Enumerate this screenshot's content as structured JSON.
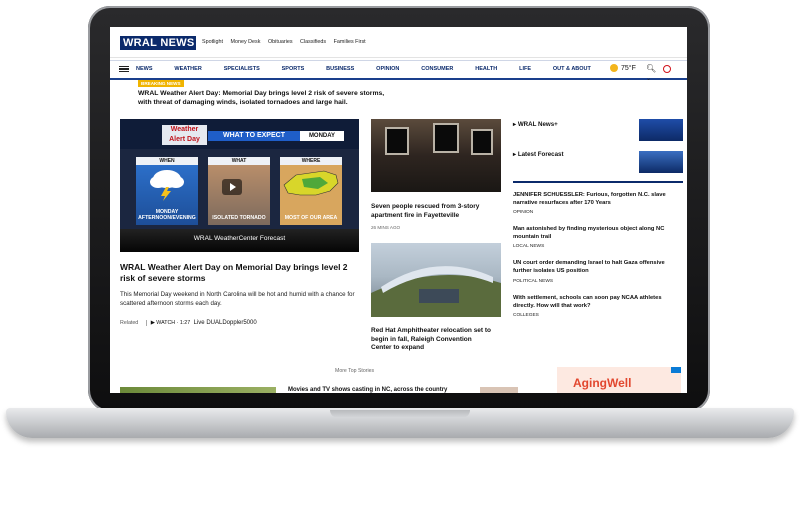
{
  "header": {
    "logo_text": "WRAL NEWS",
    "top_links": [
      "Spotlight",
      "Money Desk",
      "Obituaries",
      "Classifieds",
      "Families First"
    ]
  },
  "nav": {
    "items": [
      "NEWS",
      "WEATHER",
      "SPECIALISTS",
      "SPORTS",
      "BUSINESS",
      "OPINION",
      "CONSUMER",
      "HEALTH",
      "LIFE",
      "OUT & ABOUT"
    ],
    "temperature": "75°F"
  },
  "breaking": {
    "label": "BREAKING NEWS",
    "text": "WRAL Weather Alert Day: Memorial Day brings level 2 risk of severe storms, with threat of damaging winds, isolated tornadoes and large hail."
  },
  "hero": {
    "logo_text": "Weather Alert Day",
    "banner": "WHAT TO EXPECT",
    "day": "MONDAY",
    "panels": [
      {
        "head": "WHEN",
        "text": "MONDAY AFTERNOON/EVENING"
      },
      {
        "head": "WHAT",
        "text": "ISOLATED TORNADO"
      },
      {
        "head": "WHERE",
        "text": "MOST OF OUR AREA"
      }
    ],
    "caption": "WRAL WeatherCenter Forecast",
    "headline": "WRAL Weather Alert Day on Memorial Day brings level 2 risk of severe storms",
    "summary": "This Memorial Day weekend in North Carolina will be hot and humid with a chance for scattered afternoon storms each day.",
    "related_label": "Related",
    "related_watch": "WATCH · 1:27",
    "related_title": "Live DUALDoppler5000"
  },
  "middle": {
    "story1_title": "Seven people rescued from 3-story apartment fire in Fayetteville",
    "story1_meta": "26 MINS AGO",
    "story2_title": "Red Hat Amphitheater relocation set to begin in fall, Raleigh Convention Center to expand"
  },
  "right": {
    "link1": "WRAL News+",
    "link2": "Latest Forecast",
    "items": [
      {
        "title": "JENNIFER SCHUESSLER: Furious, forgotten N.C. slave narrative resurfaces after 170 Years",
        "tag": "OPINION"
      },
      {
        "title": "Man astonished by finding mysterious object along NC mountain trail",
        "tag": "LOCAL NEWS"
      },
      {
        "title": "UN court order demanding Israel to halt Gaza offensive further isolates US position",
        "tag": "POLITICAL NEWS"
      },
      {
        "title": "With settlement, schools can soon pay NCAA athletes directly. How will that work?",
        "tag": "COLLEGES"
      }
    ]
  },
  "more_top_stories": "More Top Stories",
  "bottom_strip_text": "Movies and TV shows casting in NC, across the country",
  "ad_text": "AgingWell",
  "colors": {
    "brand_navy": "#0b2a6b",
    "breaking_yellow": "#f0b400",
    "alert_red": "#c0121b"
  }
}
